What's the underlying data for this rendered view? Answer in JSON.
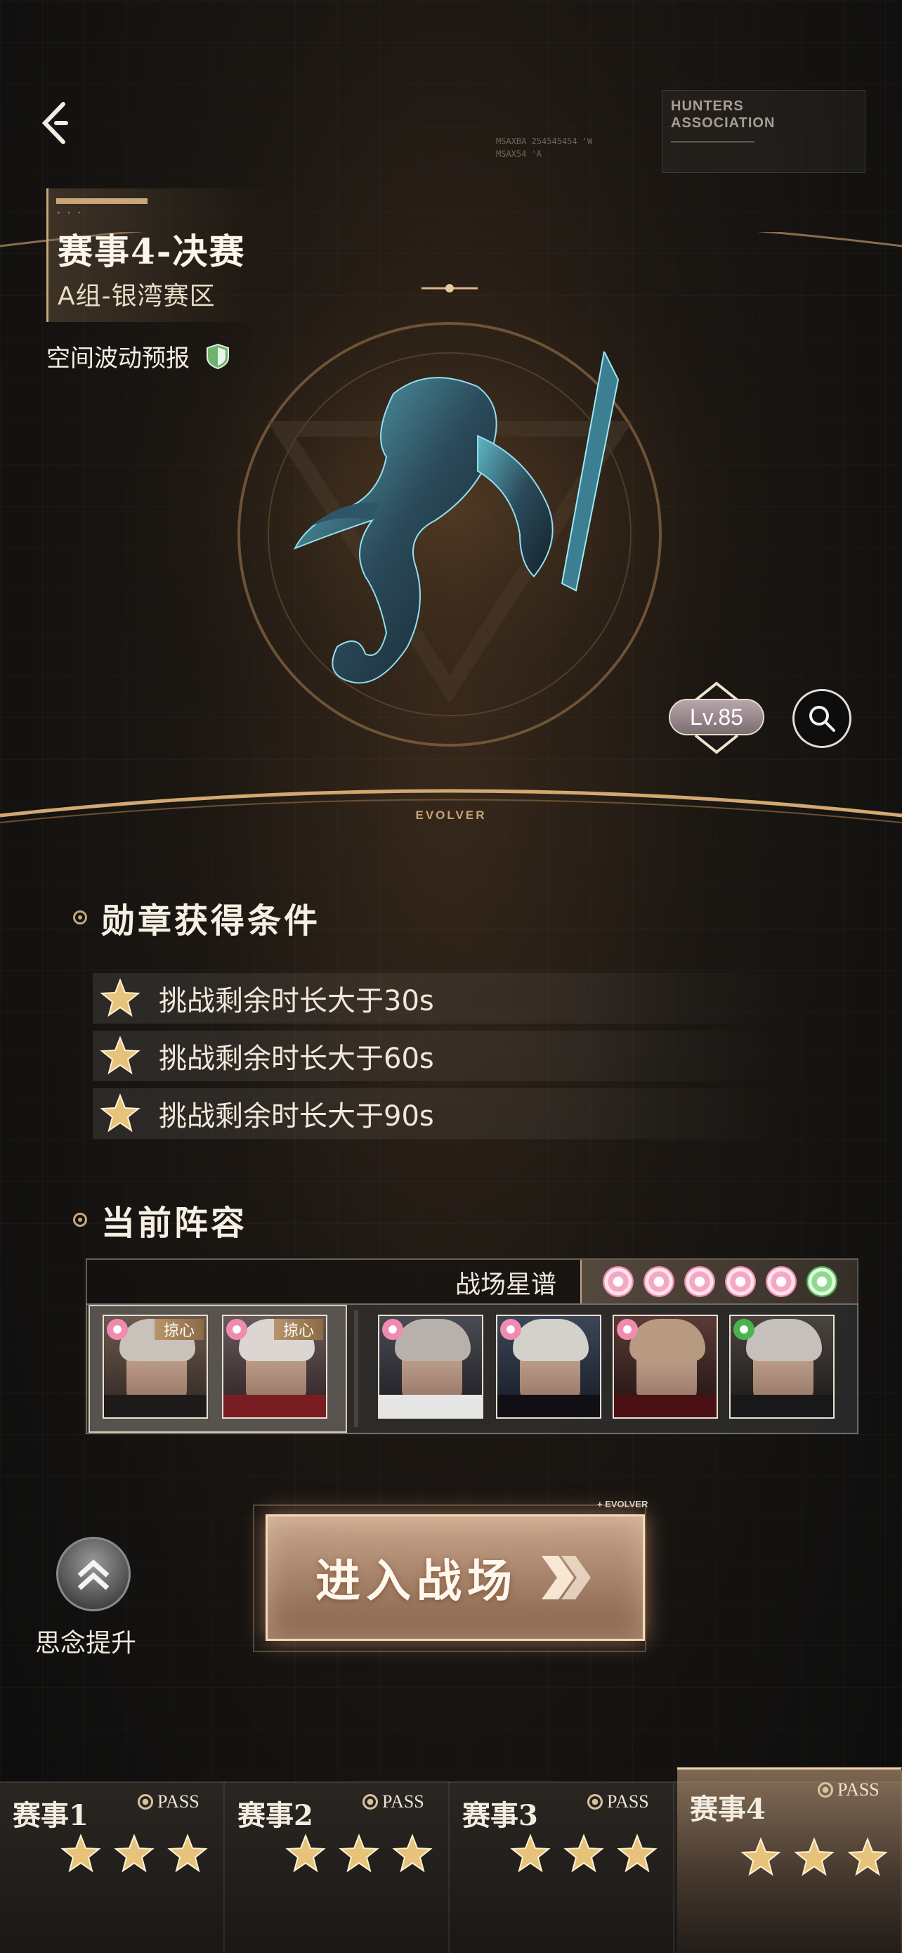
{
  "header": {
    "match_title": "赛事4-决赛",
    "group_area": "A组-银湾赛区",
    "forecast_label": "空间波动预报",
    "hud_title": "HUNTERS\nASSOCIATION",
    "hud_code": "MSAXBA 254545454 'W\nMSAX54 'A"
  },
  "arena": {
    "level": "Lv.85",
    "footer_label": "EVOLVER"
  },
  "medal": {
    "title": "勋章获得条件",
    "conditions": [
      "挑战剩余时长大于30s",
      "挑战剩余时长大于60s",
      "挑战剩余时长大于90s"
    ]
  },
  "lineup": {
    "title": "当前阵容",
    "star_chart_label": "战场星谱",
    "star_dots": [
      "pink",
      "pink",
      "pink",
      "pink",
      "pink",
      "green"
    ],
    "team_tag": "掠心",
    "team": [
      "card-1",
      "card-2"
    ],
    "bench": [
      "card-3",
      "card-4",
      "card-5",
      "card-6"
    ]
  },
  "actions": {
    "boost_label": "思念提升",
    "enter_label": "进入战场",
    "evolver_tag": "+ EVOLVER"
  },
  "tabs": [
    {
      "name": "赛事1",
      "pass": "PASS",
      "stars": 3
    },
    {
      "name": "赛事2",
      "pass": "PASS",
      "stars": 3
    },
    {
      "name": "赛事3",
      "pass": "PASS",
      "stars": 3
    },
    {
      "name": "赛事4",
      "pass": "PASS",
      "stars": 3
    }
  ],
  "colors": {
    "accent_gold": "#c9a779",
    "star_gold": "#e6c27a",
    "pink_dot": "#f08bb0",
    "green_dot": "#4cb34c"
  }
}
